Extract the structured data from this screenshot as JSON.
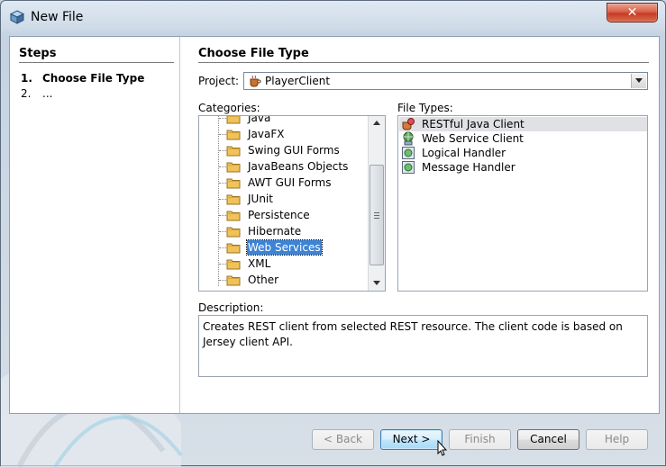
{
  "window": {
    "title": "New File",
    "close_label": "✕"
  },
  "steps": {
    "heading": "Steps",
    "items": [
      {
        "num": "1.",
        "label": "Choose File Type"
      },
      {
        "num": "2.",
        "label": "..."
      }
    ]
  },
  "main": {
    "heading": "Choose File Type",
    "project_label": "Project:",
    "project_value": "PlayerClient",
    "categories_label": "Categories:",
    "categories": [
      "Java",
      "JavaFX",
      "Swing GUI Forms",
      "JavaBeans Objects",
      "AWT GUI Forms",
      "JUnit",
      "Persistence",
      "Hibernate",
      "Web Services",
      "XML",
      "Other"
    ],
    "selected_category": "Web Services",
    "filetypes_label": "File Types:",
    "filetypes": [
      "RESTful Java Client",
      "Web Service Client",
      "Logical Handler",
      "Message Handler"
    ],
    "selected_filetype": "RESTful Java Client",
    "description_label": "Description:",
    "description_text": "Creates REST client from selected REST resource. The client code is based on Jersey client API."
  },
  "buttons": {
    "back": "< Back",
    "next": "Next >",
    "finish": "Finish",
    "cancel": "Cancel",
    "help": "Help"
  },
  "colors": {
    "selection": "#3d83d6",
    "close": "#c63b22"
  }
}
